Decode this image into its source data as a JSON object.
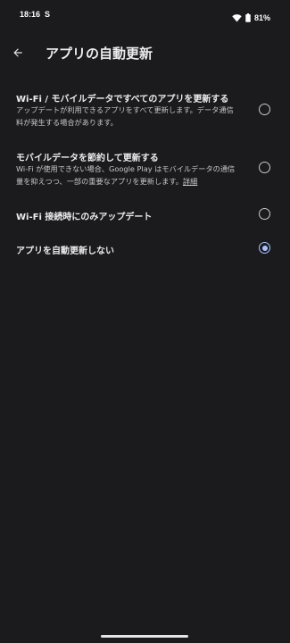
{
  "status_bar": {
    "time": "18:16",
    "carrier_icon": "S",
    "battery": "81%"
  },
  "header": {
    "title": "アプリの自動更新"
  },
  "options": [
    {
      "title": "Wi-Fi / モバイルデータですべてのアプリを更新する",
      "description": "アップデートが利用できるアプリをすべて更新します。データ通信料が発生する場合があります。",
      "selected": false
    },
    {
      "title": "モバイルデータを節約して更新する",
      "description": "Wi-Fi が使用できない場合、Google Play はモバイルデータの通信量を抑えつつ、一部の重要なアプリを更新します。",
      "link": "詳細",
      "selected": false
    },
    {
      "title": "Wi-Fi 接続時にのみアップデート",
      "selected": false
    },
    {
      "title": "アプリを自動更新しない",
      "selected": true
    }
  ],
  "colors": {
    "background": "#1b1b1d",
    "accent": "#a9c2ff"
  }
}
